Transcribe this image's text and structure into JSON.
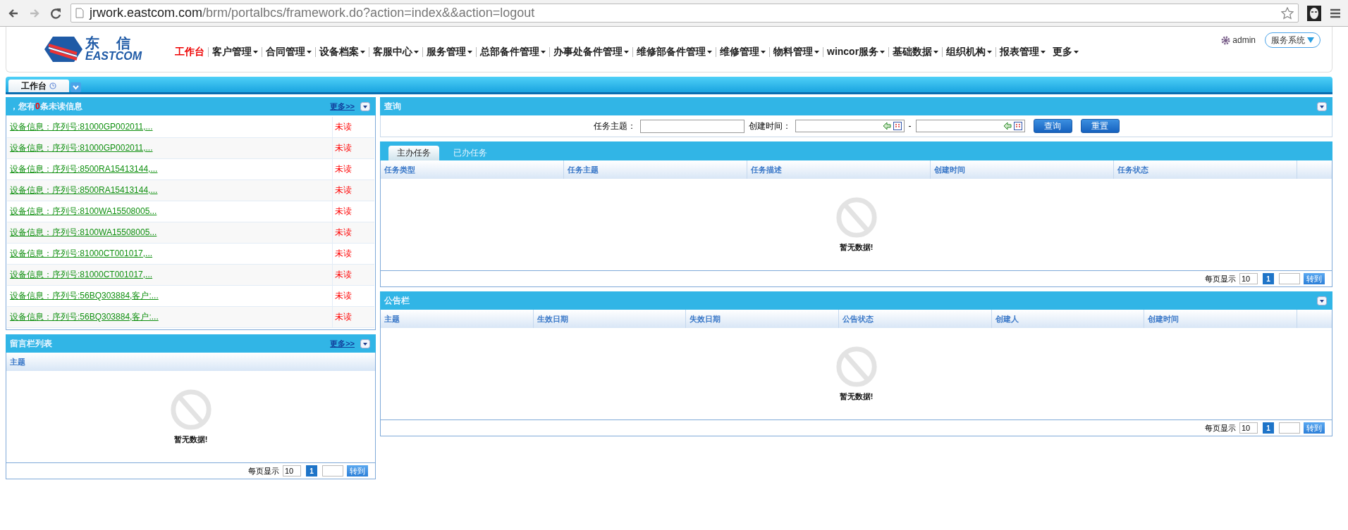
{
  "browser": {
    "url_host": "jrwork.eastcom.com",
    "url_path": "/brm/portalbcs/framework.do?action=index&&action=logout"
  },
  "header": {
    "logo_cn": "东　信",
    "logo_en": "EASTCOM",
    "user": "admin",
    "system": "服务系统",
    "nav": [
      {
        "label": "工作台",
        "selected": true,
        "has_menu": false
      },
      {
        "label": "客户管理",
        "selected": false,
        "has_menu": true
      },
      {
        "label": "合同管理",
        "selected": false,
        "has_menu": true
      },
      {
        "label": "设备档案",
        "selected": false,
        "has_menu": true
      },
      {
        "label": "客服中心",
        "selected": false,
        "has_menu": true
      },
      {
        "label": "服务管理",
        "selected": false,
        "has_menu": true
      },
      {
        "label": "总部备件管理",
        "selected": false,
        "has_menu": true
      },
      {
        "label": "办事处备件管理",
        "selected": false,
        "has_menu": true
      },
      {
        "label": "维修部备件管理",
        "selected": false,
        "has_menu": true
      },
      {
        "label": "维修管理",
        "selected": false,
        "has_menu": true
      },
      {
        "label": "物料管理",
        "selected": false,
        "has_menu": true
      },
      {
        "label": "wincor服务",
        "selected": false,
        "has_menu": true
      },
      {
        "label": "基础数据",
        "selected": false,
        "has_menu": true
      },
      {
        "label": "组织机构",
        "selected": false,
        "has_menu": true
      },
      {
        "label": "报表管理",
        "selected": false,
        "has_menu": true
      },
      {
        "label": "更多",
        "selected": false,
        "has_menu": true
      }
    ]
  },
  "page_tabs": [
    {
      "label": "工作台",
      "selected": true
    }
  ],
  "messages": {
    "title_before": "，您有",
    "unread_count": "0",
    "title_after": "条未读信息",
    "more": "更多>>",
    "rows": [
      {
        "text": "设备信息：序列号:81000GP002011,...",
        "status": "未读"
      },
      {
        "text": "设备信息：序列号:81000GP002011,...",
        "status": "未读"
      },
      {
        "text": "设备信息：序列号:8500RA15413144,...",
        "status": "未读"
      },
      {
        "text": "设备信息：序列号:8500RA15413144,...",
        "status": "未读"
      },
      {
        "text": "设备信息：序列号:8100WA15508005...",
        "status": "未读"
      },
      {
        "text": "设备信息：序列号:8100WA15508005...",
        "status": "未读"
      },
      {
        "text": "设备信息：序列号:81000CT001017,...",
        "status": "未读"
      },
      {
        "text": "设备信息：序列号:81000CT001017,...",
        "status": "未读"
      },
      {
        "text": "设备信息：序列号:56BQ303884,客户:...",
        "status": "未读"
      },
      {
        "text": "设备信息：序列号:56BQ303884,客户:...",
        "status": "未读"
      }
    ]
  },
  "guestbook": {
    "title": "留言栏列表",
    "more": "更多>>",
    "columns": [
      "主题"
    ],
    "empty": "暂无数据!",
    "pager": {
      "label": "每页显示",
      "page_size": "10",
      "page": "1",
      "go": "转到"
    }
  },
  "query": {
    "title": "查询",
    "subject_label": "任务主题：",
    "time_label": "创建时间：",
    "range_sep": "-",
    "search": "查询",
    "reset": "重置"
  },
  "tasks": {
    "tabs": [
      {
        "label": "主办任务",
        "selected": true
      },
      {
        "label": "已办任务",
        "selected": false
      }
    ],
    "columns": [
      "任务类型",
      "任务主题",
      "任务描述",
      "创建时间",
      "任务状态"
    ],
    "empty": "暂无数据!",
    "pager": {
      "label": "每页显示",
      "page_size": "10",
      "page": "1",
      "go": "转到"
    }
  },
  "notices": {
    "title": "公告栏",
    "columns": [
      "主题",
      "生效日期",
      "失效日期",
      "公告状态",
      "创建人",
      "创建时间"
    ],
    "empty": "暂无数据!",
    "pager": {
      "label": "每页显示",
      "page_size": "10",
      "page": "1",
      "go": "转到"
    }
  }
}
